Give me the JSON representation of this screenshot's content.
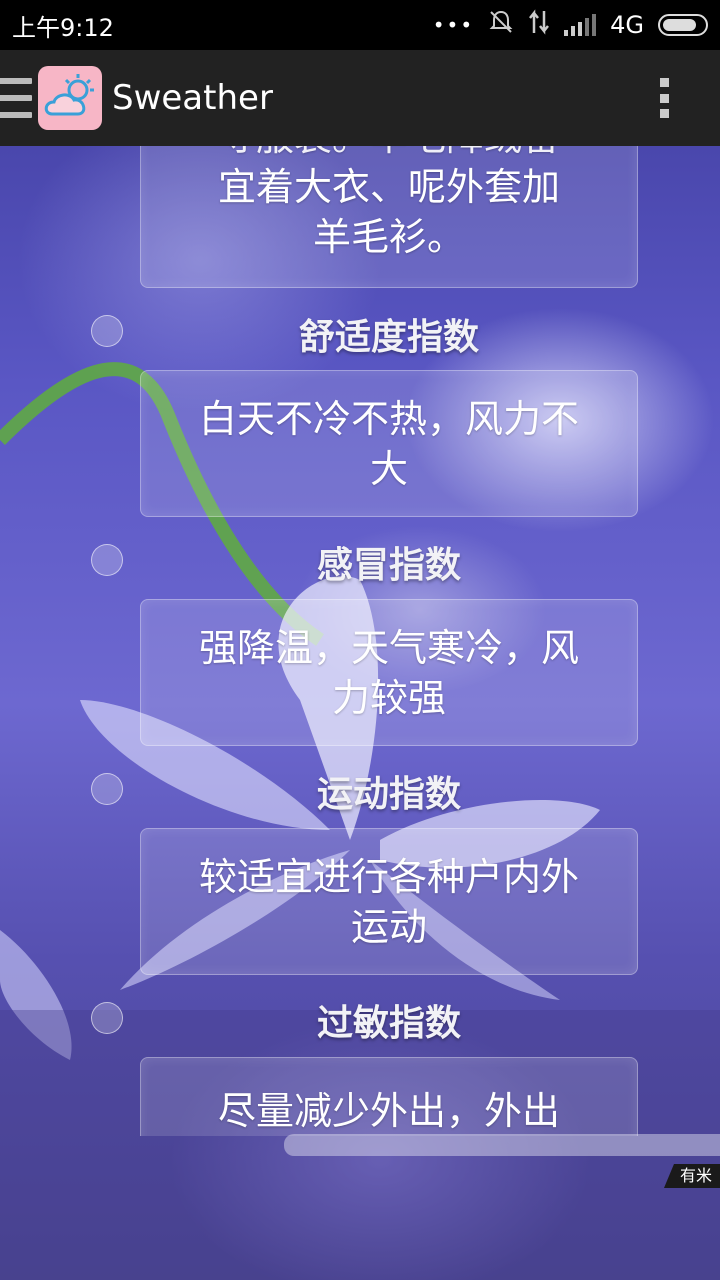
{
  "status_bar": {
    "time": "上午9:12",
    "dots": "•••",
    "network": "4G"
  },
  "action_bar": {
    "title": "Sweather"
  },
  "sections": [
    {
      "heading": "",
      "text": "寻服装。羊毛降绒番宜着大衣、呢外套加羊毛衫。"
    },
    {
      "heading": "舒适度指数",
      "text": "白天不冷不热，风力不大"
    },
    {
      "heading": "感冒指数",
      "text": "强降温，天气寒冷，风力较强"
    },
    {
      "heading": "运动指数",
      "text": "较适宜进行各种户内外运动"
    },
    {
      "heading": "过敏指数",
      "text": "尽量减少外出，外出"
    }
  ],
  "first_card_lines": [
    "寻服装。羊毛降绒番",
    "宜着大衣、呢外套加",
    "羊毛衫。"
  ],
  "watermark": "有米"
}
